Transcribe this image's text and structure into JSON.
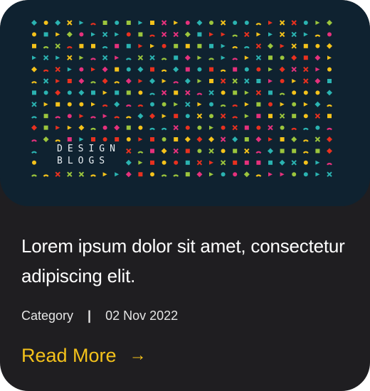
{
  "card": {
    "image": {
      "brand_line1": "DESIGN",
      "brand_line2": "BLOGS",
      "palette": [
        "#f4c21b",
        "#e8311f",
        "#2bb3b1",
        "#9bc53d",
        "#e5317c",
        "#ffffff"
      ],
      "background": "#0f2230"
    },
    "title": "Lorem ipsum dolor sit amet, consectetur adipiscing elit.",
    "category": "Category",
    "separator": "|",
    "date": "02 Nov 2022",
    "read_more_label": "Read More",
    "read_more_arrow": "→",
    "colors": {
      "card_bg": "#1f1e21",
      "accent": "#f4c21b",
      "text": "#ffffff"
    }
  }
}
